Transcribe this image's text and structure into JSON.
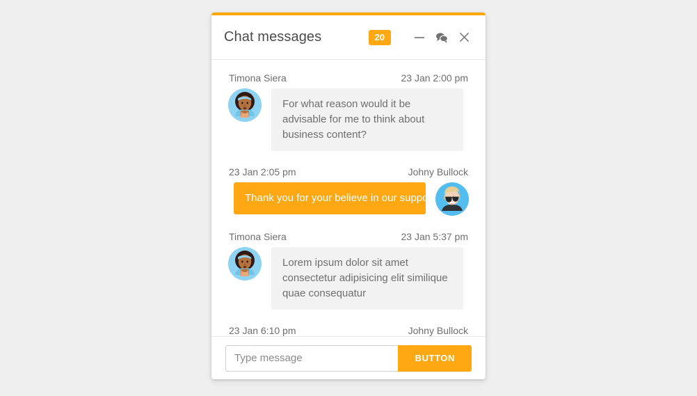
{
  "window": {
    "accent_color": "#ffa813",
    "background_color": "#efefef",
    "card_background": "#ffffff"
  },
  "header": {
    "title": "Chat messages",
    "badge_count": "20",
    "icons": [
      {
        "name": "minimize-icon",
        "glyph": "minus"
      },
      {
        "name": "comments-icon",
        "glyph": "chat-bubbles"
      },
      {
        "name": "close-icon",
        "glyph": "times"
      }
    ]
  },
  "messages": [
    {
      "side": "left",
      "author": "Timona Siera",
      "time": "23 Jan 2:00 pm",
      "text": "For what reason would it be advisable for me to think about business content?",
      "avatar": "woman-afro-avatar"
    },
    {
      "side": "right",
      "author": "Johny Bullock",
      "time": "23 Jan 2:05 pm",
      "text": "Thank you for your believe in our supports",
      "avatar": "man-sunglasses-avatar"
    },
    {
      "side": "left",
      "author": "Timona Siera",
      "time": "23 Jan 5:37 pm",
      "text": "Lorem ipsum dolor sit amet consectetur adipisicing elit similique quae consequatur",
      "avatar": "woman-afro-avatar"
    },
    {
      "side": "right",
      "author": "Johny Bullock",
      "time": "23 Jan 6:10 pm",
      "text": "",
      "avatar": "man-sunglasses-avatar"
    }
  ],
  "footer": {
    "input_value": "",
    "input_placeholder": "Type message",
    "button_label": "BUTTON"
  }
}
